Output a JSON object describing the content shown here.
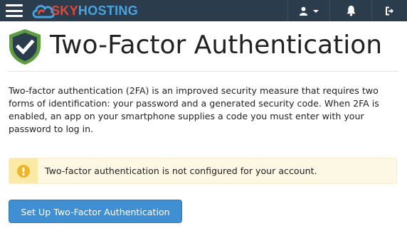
{
  "topbar": {
    "logo": {
      "part1": "SKY",
      "part2": "HOSTING"
    },
    "icons": {
      "menu": "hamburger-menu-icon",
      "user": "user-icon",
      "notifications": "bell-icon",
      "logout": "logout-icon"
    },
    "colors": {
      "background": "#2b3c4d",
      "logo_red": "#e2473a",
      "logo_blue": "#4aa3df"
    }
  },
  "header": {
    "icon": "shield-check-icon",
    "title": "Two-Factor Authentication"
  },
  "description": "Two-factor authentication (2FA) is an improved security measure that requires two forms of identification: your password and a generated security code. When 2FA is enabled, an app on your smartphone supplies a code you must enter with your password to log in.",
  "alert": {
    "type": "warning",
    "icon": "exclamation-circle-icon",
    "message": "Two-factor authentication is not configured for your account.",
    "colors": {
      "background": "#fcf8e3",
      "icon_background": "#fbe9a6",
      "icon": "#f0b429"
    }
  },
  "actions": {
    "setup_label": "Set Up Two-Factor Authentication",
    "button_color": "#3f8fd2"
  }
}
